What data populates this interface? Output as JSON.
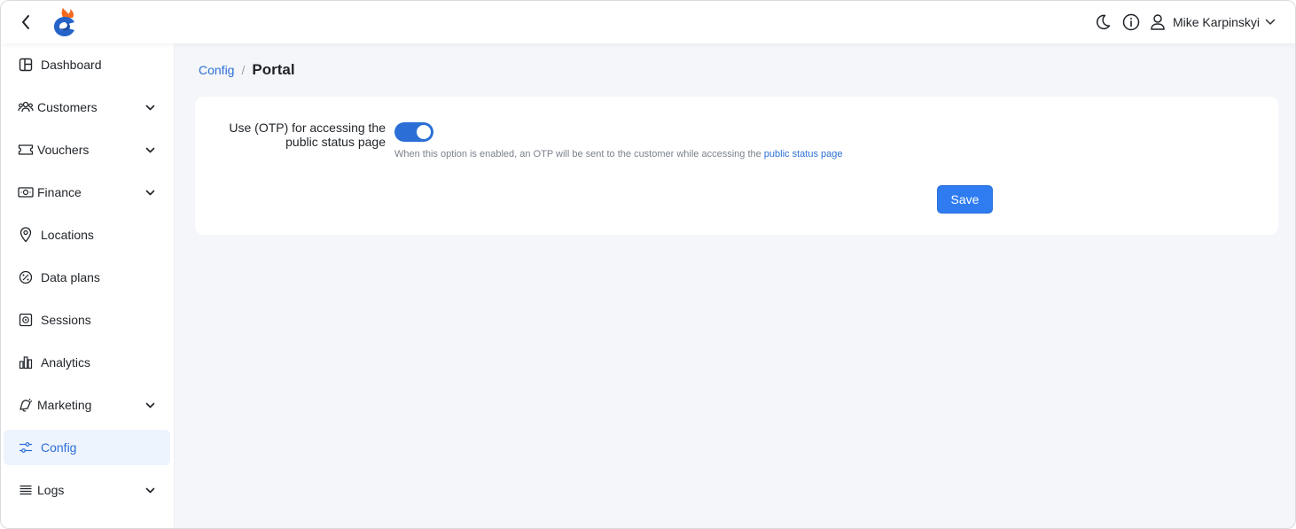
{
  "header": {
    "user_name": "Mike Karpinskyi"
  },
  "sidebar": {
    "items": [
      {
        "label": "Dashboard",
        "icon": "dashboard-icon",
        "expandable": false,
        "active": false
      },
      {
        "label": "Customers",
        "icon": "customers-icon",
        "expandable": true,
        "active": false
      },
      {
        "label": "Vouchers",
        "icon": "voucher-icon",
        "expandable": true,
        "active": false
      },
      {
        "label": "Finance",
        "icon": "finance-icon",
        "expandable": true,
        "active": false
      },
      {
        "label": "Locations",
        "icon": "location-pin-icon",
        "expandable": false,
        "active": false
      },
      {
        "label": "Data plans",
        "icon": "data-plans-icon",
        "expandable": false,
        "active": false
      },
      {
        "label": "Sessions",
        "icon": "sessions-icon",
        "expandable": false,
        "active": false
      },
      {
        "label": "Analytics",
        "icon": "analytics-icon",
        "expandable": false,
        "active": false
      },
      {
        "label": "Marketing",
        "icon": "marketing-icon",
        "expandable": true,
        "active": false
      },
      {
        "label": "Config",
        "icon": "config-sliders-icon",
        "expandable": false,
        "active": true
      },
      {
        "label": "Logs",
        "icon": "logs-icon",
        "expandable": true,
        "active": false
      }
    ]
  },
  "breadcrumb": {
    "parent": "Config",
    "separator": "/",
    "current": "Portal"
  },
  "settings": {
    "otp_label": "Use (OTP) for accessing the public status page",
    "otp_enabled": true,
    "help_text": "When this option is enabled, an OTP will be sent to the customer while accessing the ",
    "help_link": "public status page",
    "save_label": "Save"
  },
  "colors": {
    "accent": "#2b6fd6",
    "button": "#2f7cf1",
    "background": "#f4f6fa",
    "active_nav_bg": "#eef4fd"
  }
}
